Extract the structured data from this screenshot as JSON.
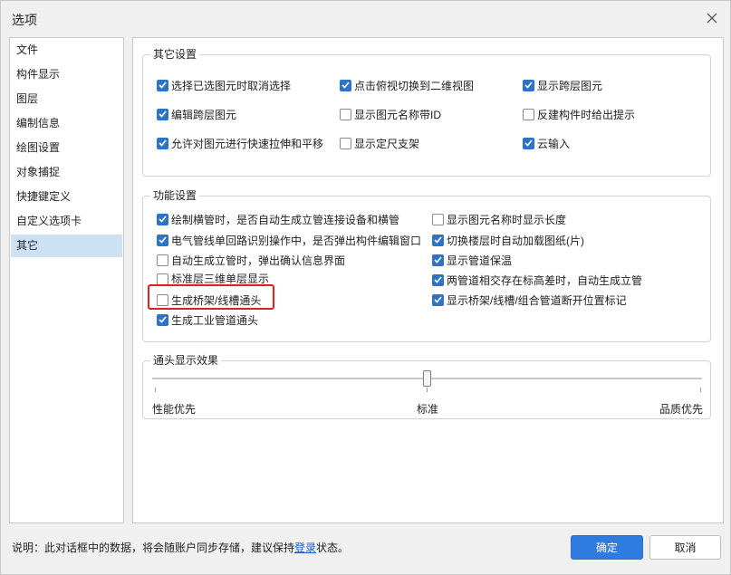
{
  "window": {
    "title": "选项"
  },
  "sidebar": {
    "items": [
      {
        "label": "文件"
      },
      {
        "label": "构件显示"
      },
      {
        "label": "图层"
      },
      {
        "label": "编制信息"
      },
      {
        "label": "绘图设置"
      },
      {
        "label": "对象捕捉"
      },
      {
        "label": "快捷键定义"
      },
      {
        "label": "自定义选项卡"
      },
      {
        "label": "其它",
        "active": true
      }
    ]
  },
  "other_settings": {
    "legend": "其它设置",
    "options": [
      {
        "label": "选择已选图元时取消选择",
        "checked": true
      },
      {
        "label": "点击俯视切换到二维视图",
        "checked": true
      },
      {
        "label": "显示跨层图元",
        "checked": true
      },
      {
        "label": "编辑跨层图元",
        "checked": true
      },
      {
        "label": "显示图元名称带ID",
        "checked": false
      },
      {
        "label": "反建构件时给出提示",
        "checked": false
      },
      {
        "label": "允许对图元进行快速拉伸和平移",
        "checked": true
      },
      {
        "label": "显示定尺支架",
        "checked": false
      },
      {
        "label": "云输入",
        "checked": true
      }
    ]
  },
  "function_settings": {
    "legend": "功能设置",
    "left": [
      {
        "label": "绘制横管时，是否自动生成立管连接设备和横管",
        "checked": true
      },
      {
        "label": "电气管线单回路识别操作中，是否弹出构件编辑窗口",
        "checked": true
      },
      {
        "label": "自动生成立管时，弹出确认信息界面",
        "checked": false
      },
      {
        "label": "标准层三维单层显示",
        "checked": false
      },
      {
        "label": "生成桥架/线槽通头",
        "checked": false
      },
      {
        "label": "生成工业管道通头",
        "checked": true
      }
    ],
    "right": [
      {
        "label": "显示图元名称时显示长度",
        "checked": false
      },
      {
        "label": "切换楼层时自动加载图纸(片)",
        "checked": true
      },
      {
        "label": "显示管道保温",
        "checked": true
      },
      {
        "label": "两管道相交存在标高差时，自动生成立管",
        "checked": true
      },
      {
        "label": "显示桥架/线槽/组合管道断开位置标记",
        "checked": true
      }
    ]
  },
  "fitting_display": {
    "legend": "通头显示效果",
    "labels": {
      "left": "性能优先",
      "middle": "标准",
      "right": "品质优先"
    },
    "slider_value": 0.5,
    "slider_value_text": "标准"
  },
  "footer": {
    "note_prefix": "说明：此对话框中的数据，将会随账户同步存储，建议保持",
    "note_link": "登录",
    "note_suffix": "状态。",
    "ok_label": "确定",
    "cancel_label": "取消"
  },
  "colors": {
    "accent": "#2f7be0",
    "checkbox_checked": "#2d73c7",
    "highlight": "#e02020",
    "selected_row": "#cde1f4"
  }
}
